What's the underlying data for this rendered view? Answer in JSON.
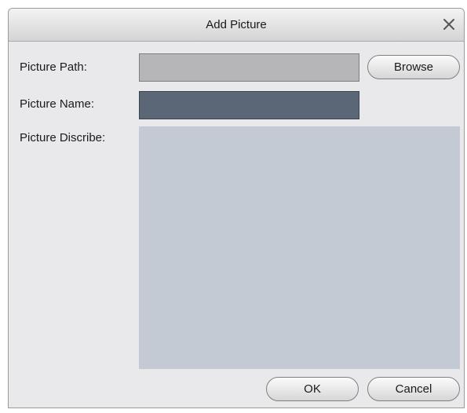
{
  "dialog": {
    "title": "Add Picture",
    "close_icon": "close-icon"
  },
  "form": {
    "path_label": "Picture Path:",
    "path_value": "",
    "name_label": "Picture Name:",
    "name_value": "",
    "describe_label": "Picture Discribe:",
    "describe_value": ""
  },
  "buttons": {
    "browse_label": "Browse",
    "ok_label": "OK",
    "cancel_label": "Cancel"
  },
  "colors": {
    "dialog_background": "#e9e9ec",
    "path_field": "#b6b6b8",
    "name_field": "#5b6676",
    "describe_field": "#c3cad4"
  }
}
